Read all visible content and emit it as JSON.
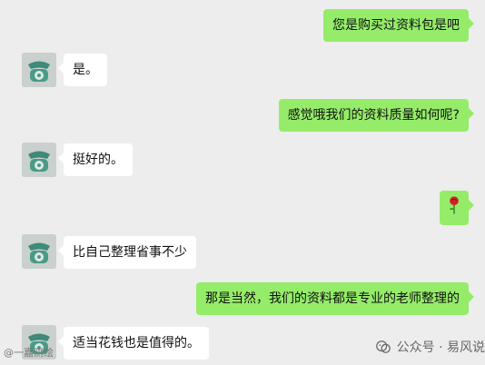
{
  "messages": [
    {
      "side": "out",
      "text": "您是购买过资料包是吧"
    },
    {
      "side": "in",
      "text": "是。"
    },
    {
      "side": "out",
      "text": "感觉哦我们的资料质量如何呢?"
    },
    {
      "side": "in",
      "text": "挺好的。"
    },
    {
      "side": "out",
      "emoji": "rose-icon"
    },
    {
      "side": "in",
      "text": "比自己整理省事不少"
    },
    {
      "side": "out",
      "text": "那是当然，我们的资料都是专业的老师整理的"
    },
    {
      "side": "in",
      "text": "适当花钱也是值得的。"
    }
  ],
  "watermark": {
    "left_text": "@一嘉测绘",
    "right_text": "公众号 · 易风说"
  },
  "colors": {
    "outgoing_bubble": "#95ec69",
    "incoming_bubble": "#ffffff",
    "background": "#ededed"
  }
}
